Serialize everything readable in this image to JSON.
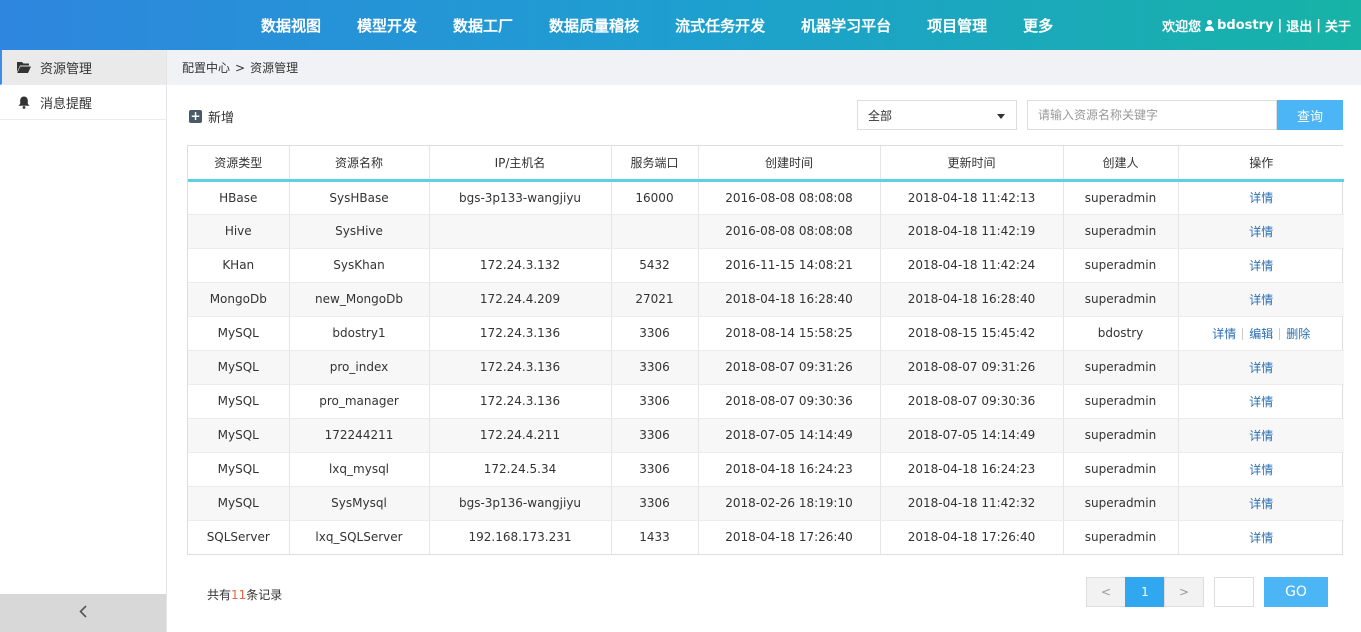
{
  "header": {
    "nav": [
      "数据视图",
      "模型开发",
      "数据工厂",
      "数据质量稽核",
      "流式任务开发",
      "机器学习平台",
      "项目管理",
      "更多"
    ],
    "welcome": "欢迎您",
    "username": "bdostry",
    "logout": "退出",
    "about": "关于",
    "separator": "|"
  },
  "sidebar": {
    "items": [
      {
        "label": "资源管理",
        "icon": "folder-open-icon",
        "active": true
      },
      {
        "label": "消息提醒",
        "icon": "bell-icon",
        "active": false
      }
    ],
    "collapse_icon": "chevron-left-icon"
  },
  "breadcrumb": {
    "items": [
      "配置中心",
      "资源管理"
    ],
    "separator": ">"
  },
  "toolbar": {
    "add_label": "新增",
    "select_value": "全部",
    "search_placeholder": "请输入资源名称关键字",
    "search_label": "查询"
  },
  "table": {
    "columns": [
      "资源类型",
      "资源名称",
      "IP/主机名",
      "服务端口",
      "创建时间",
      "更新时间",
      "创建人",
      "操作"
    ],
    "rows": [
      {
        "type": "HBase",
        "name": "SysHBase",
        "host": "bgs-3p133-wangjiyu",
        "port": "16000",
        "created": "2016-08-08 08:08:08",
        "updated": "2018-04-18 11:42:13",
        "creator": "superadmin",
        "actions": [
          "详情"
        ]
      },
      {
        "type": "Hive",
        "name": "SysHive",
        "host": "",
        "port": "",
        "created": "2016-08-08 08:08:08",
        "updated": "2018-04-18 11:42:19",
        "creator": "superadmin",
        "actions": [
          "详情"
        ]
      },
      {
        "type": "KHan",
        "name": "SysKhan",
        "host": "172.24.3.132",
        "port": "5432",
        "created": "2016-11-15 14:08:21",
        "updated": "2018-04-18 11:42:24",
        "creator": "superadmin",
        "actions": [
          "详情"
        ]
      },
      {
        "type": "MongoDb",
        "name": "new_MongoDb",
        "host": "172.24.4.209",
        "port": "27021",
        "created": "2018-04-18 16:28:40",
        "updated": "2018-04-18 16:28:40",
        "creator": "superadmin",
        "actions": [
          "详情"
        ]
      },
      {
        "type": "MySQL",
        "name": "bdostry1",
        "host": "172.24.3.136",
        "port": "3306",
        "created": "2018-08-14 15:58:25",
        "updated": "2018-08-15 15:45:42",
        "creator": "bdostry",
        "actions": [
          "详情",
          "编辑",
          "删除"
        ]
      },
      {
        "type": "MySQL",
        "name": "pro_index",
        "host": "172.24.3.136",
        "port": "3306",
        "created": "2018-08-07 09:31:26",
        "updated": "2018-08-07 09:31:26",
        "creator": "superadmin",
        "actions": [
          "详情"
        ]
      },
      {
        "type": "MySQL",
        "name": "pro_manager",
        "host": "172.24.3.136",
        "port": "3306",
        "created": "2018-08-07 09:30:36",
        "updated": "2018-08-07 09:30:36",
        "creator": "superadmin",
        "actions": [
          "详情"
        ]
      },
      {
        "type": "MySQL",
        "name": "172244211",
        "host": "172.24.4.211",
        "port": "3306",
        "created": "2018-07-05 14:14:49",
        "updated": "2018-07-05 14:14:49",
        "creator": "superadmin",
        "actions": [
          "详情"
        ]
      },
      {
        "type": "MySQL",
        "name": "lxq_mysql",
        "host": "172.24.5.34",
        "port": "3306",
        "created": "2018-04-18 16:24:23",
        "updated": "2018-04-18 16:24:23",
        "creator": "superadmin",
        "actions": [
          "详情"
        ]
      },
      {
        "type": "MySQL",
        "name": "SysMysql",
        "host": "bgs-3p136-wangjiyu",
        "port": "3306",
        "created": "2018-02-26 18:19:10",
        "updated": "2018-04-18 11:42:32",
        "creator": "superadmin",
        "actions": [
          "详情"
        ]
      },
      {
        "type": "SQLServer",
        "name": "lxq_SQLServer",
        "host": "192.168.173.231",
        "port": "1433",
        "created": "2018-04-18 17:26:40",
        "updated": "2018-04-18 17:26:40",
        "creator": "superadmin",
        "actions": [
          "详情"
        ]
      }
    ]
  },
  "footer": {
    "total_prefix": "共有",
    "total_count": "11",
    "total_suffix": "条记录",
    "prev": "<",
    "current_page": "1",
    "next": ">",
    "page_input": "",
    "go_label": "GO"
  },
  "colors": {
    "accent": "#31a7f0",
    "header_start": "#2e86de",
    "header_end": "#17b3a6",
    "table_header_line": "#5bd1e3",
    "link": "#2a6fb5",
    "count": "#e8643c"
  }
}
